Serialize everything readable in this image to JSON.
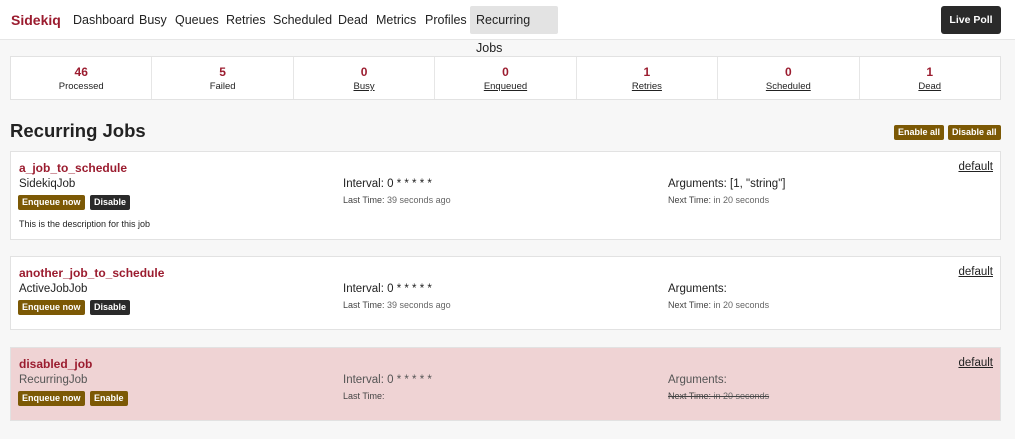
{
  "nav": {
    "brand": "Sidekiq",
    "items": [
      "Dashboard",
      "Busy",
      "Queues",
      "Retries",
      "Scheduled",
      "Dead",
      "Metrics",
      "Profiles",
      "Recurring Jobs"
    ],
    "active": "Recurring Jobs",
    "live_poll": "Live Poll"
  },
  "stats": [
    {
      "value": "46",
      "label": "Processed"
    },
    {
      "value": "5",
      "label": "Failed"
    },
    {
      "value": "0",
      "label": "Busy"
    },
    {
      "value": "0",
      "label": "Enqueued"
    },
    {
      "value": "1",
      "label": "Retries"
    },
    {
      "value": "0",
      "label": "Scheduled"
    },
    {
      "value": "1",
      "label": "Dead"
    }
  ],
  "page": {
    "title": "Recurring Jobs",
    "enable_all": "Enable all",
    "disable_all": "Disable all"
  },
  "jobs": [
    {
      "name": "a_job_to_schedule",
      "class": "SidekiqJob",
      "enqueue_label": "Enqueue now",
      "toggle_label": "Disable",
      "description": "This is the description for this job",
      "interval_label": "Interval:",
      "interval": "0 * * * * *",
      "last_time_label": "Last Time:",
      "last_time": "39 seconds ago",
      "arguments_label": "Arguments:",
      "arguments": "[1, \"string\"]",
      "next_time_label": "Next Time:",
      "next_time": "in 20 seconds",
      "queue": "default"
    },
    {
      "name": "another_job_to_schedule",
      "class": "ActiveJobJob",
      "enqueue_label": "Enqueue now",
      "toggle_label": "Disable",
      "interval_label": "Interval:",
      "interval": "0 * * * * *",
      "last_time_label": "Last Time:",
      "last_time": "39 seconds ago",
      "arguments_label": "Arguments:",
      "arguments": "",
      "next_time_label": "Next Time:",
      "next_time": "in 20 seconds",
      "queue": "default"
    },
    {
      "name": "disabled_job",
      "class": "RecurringJob",
      "enqueue_label": "Enqueue now",
      "toggle_label": "Enable",
      "interval_label": "Interval:",
      "interval": "0 * * * * *",
      "last_time_label": "Last Time:",
      "last_time": "",
      "arguments_label": "Arguments:",
      "arguments": "",
      "next_time_label": "Next Time:",
      "next_time": "in 20 seconds",
      "queue": "default"
    }
  ],
  "colors": {
    "brand": "#9b1c2f",
    "button_gold": "#7c5905",
    "button_dark": "#2a2a2a",
    "disabled_bg": "#efd3d4"
  }
}
